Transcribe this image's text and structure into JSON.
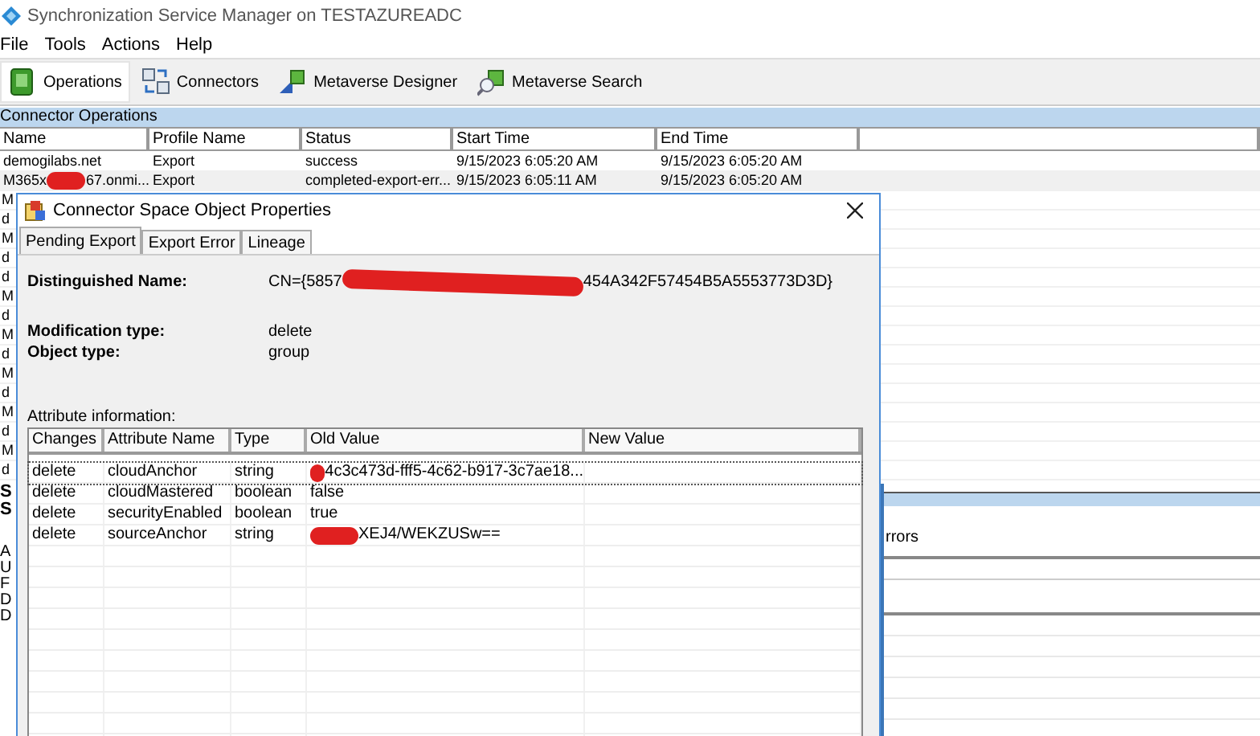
{
  "window": {
    "title": "Synchronization Service Manager on TESTAZUREADC"
  },
  "menu": [
    "File",
    "Tools",
    "Actions",
    "Help"
  ],
  "toolbar": [
    {
      "label": "Operations",
      "kind": "operations",
      "selected": true
    },
    {
      "label": "Connectors",
      "kind": "connectors",
      "selected": false
    },
    {
      "label": "Metaverse Designer",
      "kind": "designer",
      "selected": false
    },
    {
      "label": "Metaverse Search",
      "kind": "search",
      "selected": false
    }
  ],
  "operations": {
    "title": "Connector Operations",
    "columns": [
      "Name",
      "Profile Name",
      "Status",
      "Start Time",
      "End Time"
    ],
    "rows": [
      {
        "selected": false,
        "cells": [
          "demogilabs.net",
          "Export",
          "success",
          "9/15/2023 6:05:20 AM",
          "9/15/2023 6:05:20 AM"
        ]
      },
      {
        "selected": true,
        "cells": [
          [
            "M365x",
            "67.onmi..."
          ],
          "Export",
          "completed-export-err...",
          "9/15/2023 6:05:11 AM",
          "9/15/2023 6:05:20 AM"
        ]
      }
    ],
    "hidden_rows": [
      "M",
      "d",
      "M",
      "d",
      "d",
      "M",
      "d",
      "M",
      "d",
      "M",
      "d",
      "M",
      "d",
      "M",
      "d"
    ]
  },
  "details": {
    "left_labels": [
      "S",
      "S"
    ],
    "left_items": [
      "A",
      "U",
      "F",
      "D",
      "D"
    ],
    "right_label": "rrors"
  },
  "dialog": {
    "title": "Connector Space Object Properties",
    "tabs": [
      {
        "label": "Pending Export",
        "selected": true
      },
      {
        "label": "Export Error",
        "selected": false
      },
      {
        "label": "Lineage",
        "selected": false
      }
    ],
    "fields": [
      {
        "label": "Distinguished Name:",
        "value": [
          "CN={5857",
          "454A342F57454B5A5553773D3D}"
        ]
      },
      {
        "label": "Modification type:",
        "value": "delete"
      },
      {
        "label": "Object type:",
        "value": "group"
      }
    ],
    "attributes": {
      "label": "Attribute information:",
      "columns": [
        "Changes",
        "Attribute Name",
        "Type",
        "Old Value",
        "New Value"
      ],
      "rows": [
        {
          "selected": true,
          "cells": [
            "delete",
            "cloudAnchor",
            "string",
            [
              "",
              "4c3c473d-fff5-4c62-b917-3c7ae18..."
            ],
            ""
          ]
        },
        {
          "selected": false,
          "cells": [
            "delete",
            "cloudMastered",
            "boolean",
            "false",
            ""
          ]
        },
        {
          "selected": false,
          "cells": [
            "delete",
            "securityEnabled",
            "boolean",
            "true",
            ""
          ]
        },
        {
          "selected": false,
          "cells": [
            "delete",
            "sourceAnchor",
            "string",
            [
              "",
              "XEJ4/WEKZUSw=="
            ],
            ""
          ]
        }
      ]
    }
  }
}
